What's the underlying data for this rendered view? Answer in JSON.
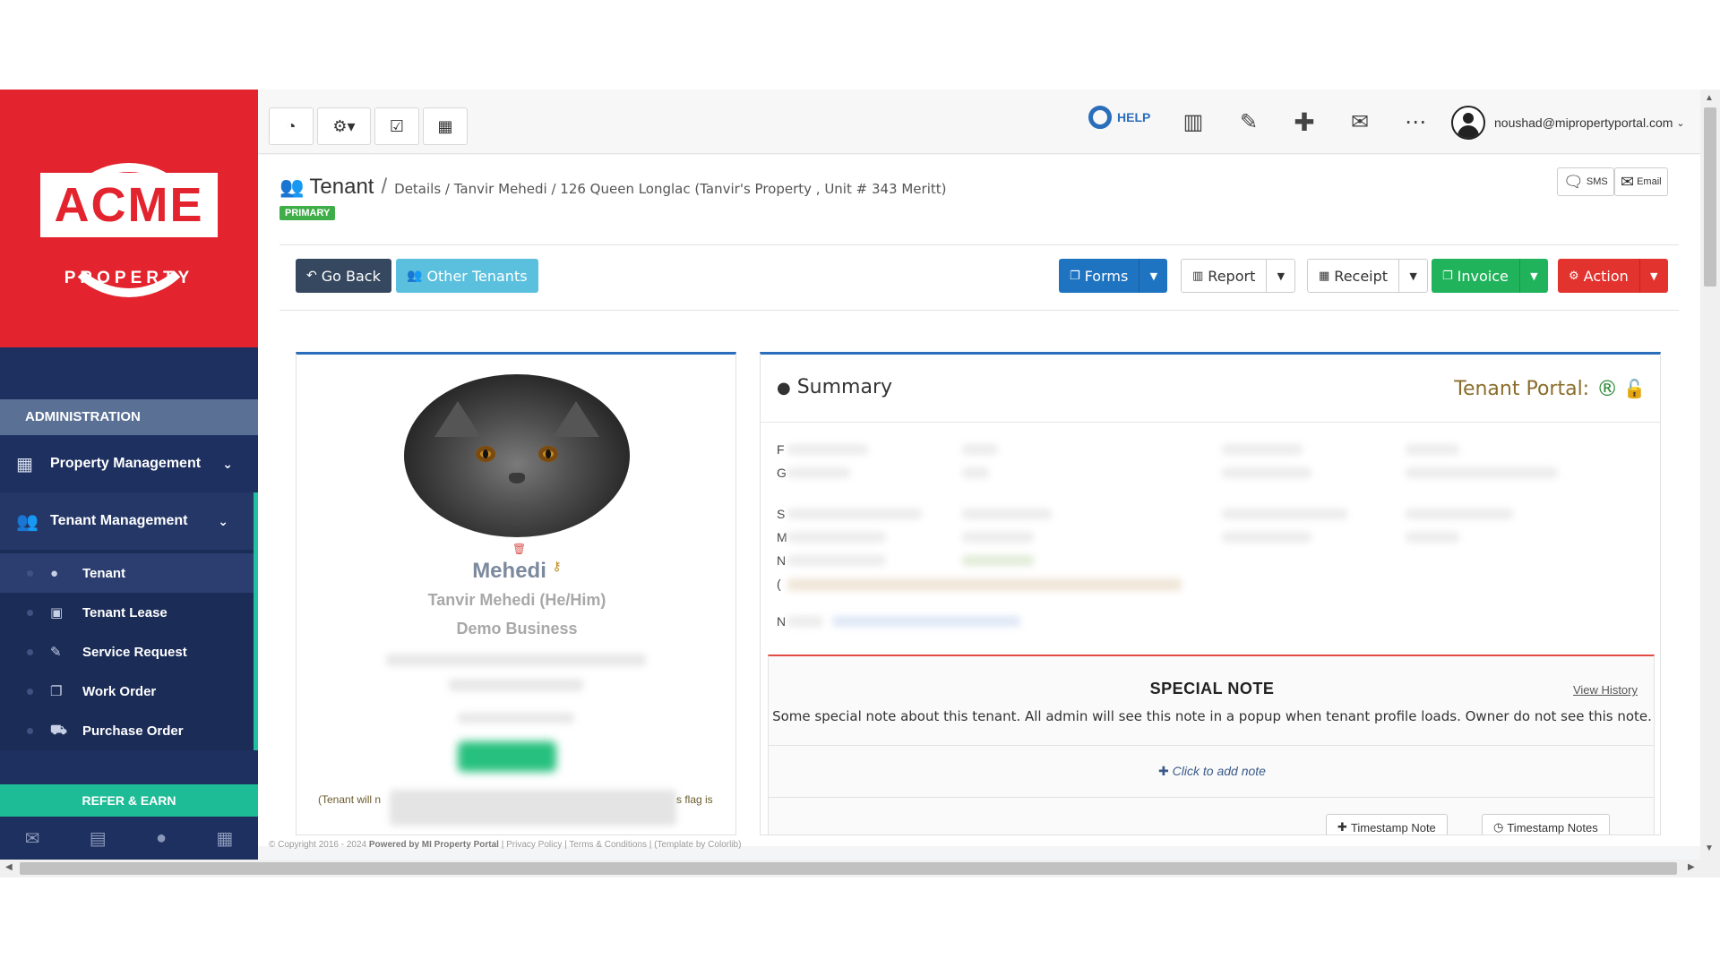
{
  "sidebar": {
    "logo_main": "ACME",
    "logo_sub": "PROPERTY",
    "section": "ADMINISTRATION",
    "items": [
      {
        "label": "Property Management",
        "icon": "building-icon"
      },
      {
        "label": "Tenant Management",
        "icon": "users-icon"
      }
    ],
    "sub_items": [
      {
        "label": "Tenant",
        "icon": "user-icon"
      },
      {
        "label": "Tenant Lease",
        "icon": "calendar-check-icon"
      },
      {
        "label": "Service Request",
        "icon": "wrench-icon"
      },
      {
        "label": "Work Order",
        "icon": "copy-icon"
      },
      {
        "label": "Purchase Order",
        "icon": "truck-icon"
      }
    ],
    "refer": "REFER & EARN",
    "footer_icons": [
      "envelope-icon",
      "briefcase-icon",
      "user-icon",
      "calculator-icon"
    ]
  },
  "topbar": {
    "help": "HELP",
    "user_email": "noushad@mipropertyportal.com"
  },
  "page": {
    "title": "Tenant",
    "breadcrumb": "Details / Tanvir Mehedi / 126 Queen Longlac (Tanvir's Property , Unit # 343 Meritt)",
    "badge": "PRIMARY",
    "sms": "SMS",
    "email": "Email"
  },
  "actions": {
    "go_back": "Go Back",
    "other_tenants": "Other Tenants",
    "forms": "Forms",
    "report": "Report",
    "receipt": "Receipt",
    "invoice": "Invoice",
    "action": "Action"
  },
  "profile": {
    "name": "Mehedi",
    "full_name": "Tanvir Mehedi (He/Him)",
    "business": "Demo Business",
    "note_left": "(Tenant will n",
    "note_right": "s flag is"
  },
  "summary": {
    "title": "Summary",
    "portal_label": "Tenant Portal:",
    "row_letters": [
      "F",
      "G",
      "S",
      "M",
      "N",
      "(",
      "N"
    ]
  },
  "special_note": {
    "title": "SPECIAL NOTE",
    "history": "View History",
    "text": "Some special note about this tenant. All admin will see this note in a popup when tenant profile loads. Owner do not see this note.",
    "add": "Click to add note",
    "btn1": "Timestamp Note",
    "btn2": "Timestamp Notes"
  },
  "footer": {
    "copyright": "© Copyright 2016 - 2024",
    "powered": "Powered by MI Property Portal",
    "links": "| Privacy Policy | Terms & Conditions | (Template by Colorlib)"
  },
  "colors": {
    "brand_red": "#e3232d",
    "sidebar_navy": "#1e3060",
    "accent_teal": "#1ebb97",
    "primary_blue": "#1f74c2",
    "success_green": "#21b35b",
    "danger_red": "#e2332f"
  }
}
